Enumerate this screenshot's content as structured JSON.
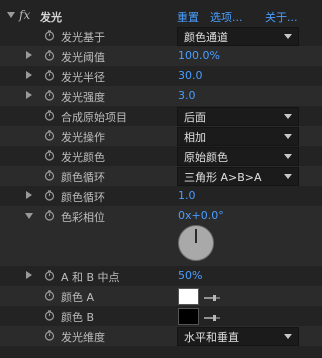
{
  "header": {
    "fx_label": "fx",
    "effect_name": "发光",
    "reset": "重置",
    "options": "选项...",
    "about": "关于..."
  },
  "rows": {
    "glow_based_on": {
      "label": "发光基于",
      "value": "颜色通道"
    },
    "glow_threshold": {
      "label": "发光阈值",
      "value": "100.0%"
    },
    "glow_radius": {
      "label": "发光半径",
      "value": "30.0"
    },
    "glow_intensity": {
      "label": "发光强度",
      "value": "3.0"
    },
    "composite_original": {
      "label": "合成原始项目",
      "value": "后面"
    },
    "glow_operation": {
      "label": "发光操作",
      "value": "相加"
    },
    "glow_colors": {
      "label": "发光颜色",
      "value": "原始颜色"
    },
    "color_looping": {
      "label": "颜色循环",
      "value": "三角形 A>B>A"
    },
    "color_loops": {
      "label": "颜色循环",
      "value": "1.0"
    },
    "color_phase": {
      "label": "色彩相位",
      "value": "0x+0.0°"
    },
    "ab_midpoint": {
      "label": "A 和 B 中点",
      "value": "50%"
    },
    "color_a": {
      "label": "颜色 A",
      "color": "#ffffff"
    },
    "color_b": {
      "label": "颜色 B",
      "color": "#000000"
    },
    "glow_dimensions": {
      "label": "发光维度",
      "value": "水平和垂直"
    }
  },
  "colors": {
    "link": "#4a9eff",
    "panel_bg": "#232323"
  }
}
